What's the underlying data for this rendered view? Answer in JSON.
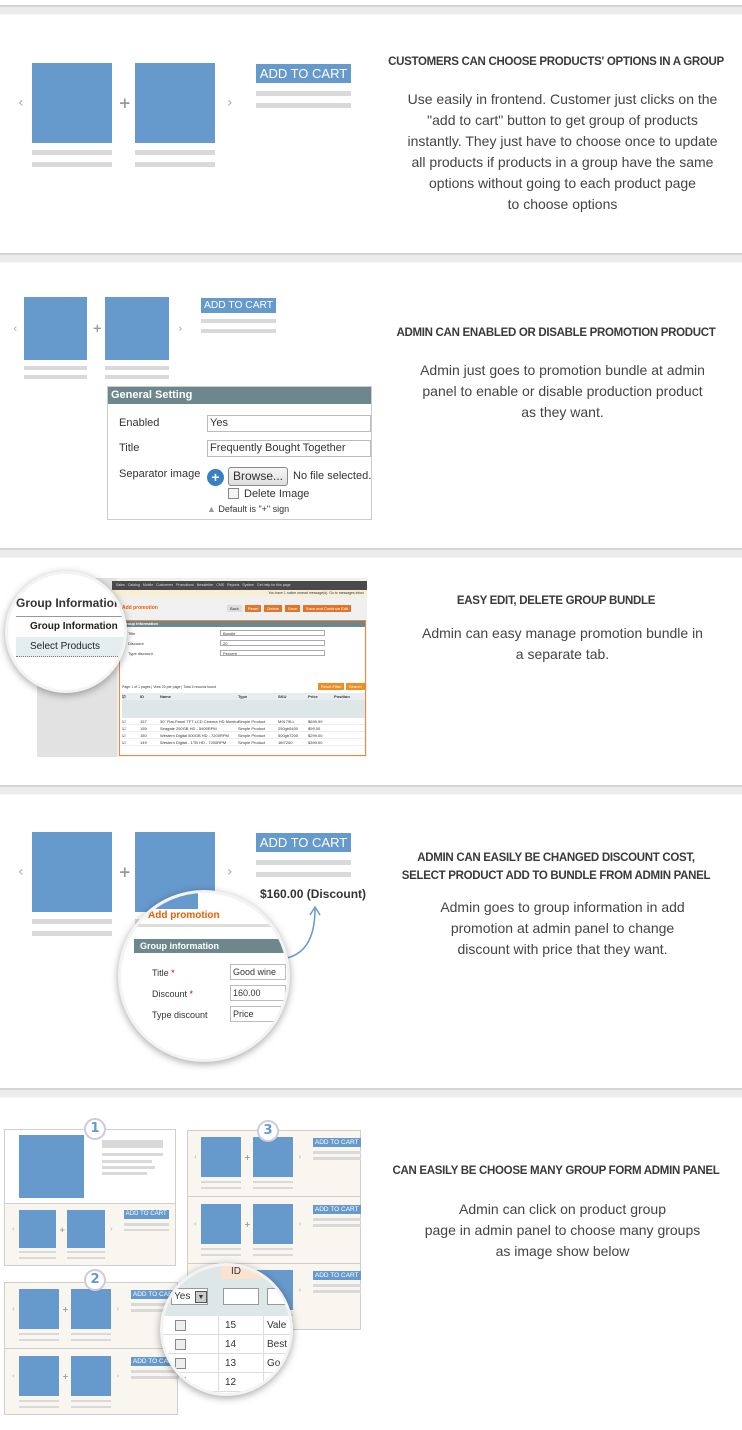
{
  "add_to_cart": "ADD TO CART",
  "colors": {
    "product_image": "#6699cc",
    "admin_bar": "#6e878d",
    "accent_orange": "#eb5e00"
  },
  "sections": [
    {
      "heading": [
        "CUSTOMERS CAN CHOOSE PRODUCTS' OPTIONS IN A GROUP"
      ],
      "text": [
        "Use easily in frontend. Customer just clicks on the",
        "\"add to cart\" button to get group of products",
        "instantly. They just have to choose once to update",
        "all products if products in a group have the same",
        "options without going to each product page",
        "to choose options"
      ]
    },
    {
      "heading": [
        "ADMIN CAN ENABLED OR DISABLE PROMOTION PRODUCT"
      ],
      "text": [
        "Admin just goes to promotion bundle at admin",
        "panel to enable or disable production product",
        "as they want."
      ]
    },
    {
      "heading": [
        "EASY EDIT, DELETE GROUP BUNDLE"
      ],
      "text": [
        "Admin can easy manage promotion bundle in",
        "a separate tab."
      ]
    },
    {
      "heading": [
        "ADMIN CAN EASILY BE CHANGED DISCOUNT COST,",
        "SELECT PRODUCT ADD TO BUNDLE FROM ADMIN PANEL"
      ],
      "text": [
        "Admin goes to group information in add",
        "promotion at admin panel to change",
        "discount with price that they want."
      ]
    },
    {
      "heading": [
        "CAN EASILY BE CHOOSE MANY GROUP FORM ADMIN PANEL"
      ],
      "text": [
        "Admin can click on product group",
        "page in admin panel to choose many groups",
        "as image show below"
      ]
    }
  ],
  "general_setting": {
    "title": "General Setting",
    "enabled_label": "Enabled",
    "enabled_value": "Yes",
    "title_label": "Title",
    "title_value": "Frequently Bought Together",
    "separator_label": "Separator image",
    "browse": "Browse...",
    "no_file": "No file selected.",
    "delete_image": "Delete Image",
    "default_note": "Default is \"+\" sign"
  },
  "group_tabs": {
    "heading": "Group Information",
    "items": [
      "Group Information",
      "Select Products"
    ]
  },
  "admin": {
    "nav": [
      "Sales",
      "Catalog",
      "Mobile",
      "Customers",
      "Promotions",
      "Newsletter",
      "CMS",
      "Reports",
      "System",
      "Get help for this page"
    ],
    "notice": "You have 1 notice unread message(s). Go to messages inbox",
    "page_title": "Add promotion",
    "buttons": [
      "Back",
      "Reset",
      "Delete",
      "Save",
      "Save and Continue Edit"
    ],
    "section": "Group information",
    "fields": [
      {
        "label": "Title",
        "value": "Bundle"
      },
      {
        "label": "Discount",
        "value": "20"
      },
      {
        "label": "Type discount",
        "value": "Percent"
      }
    ],
    "pager": "Page 1 of 1 pages | View 20 per page | Total 4 records found",
    "reset_filter": "Reset Filter",
    "search": "Search",
    "columns": [
      "ID",
      "Name",
      "Type",
      "SKU",
      "Price",
      "Position"
    ],
    "rows": [
      [
        "157",
        "30\" Flat-Panel TFT-LCD Cinema HD Monitor",
        "Simple Product",
        "M9179LL",
        "$699.99"
      ],
      [
        "155",
        "Seagate 250GB HD - 5400RPM",
        "Simple Product",
        "250gb5400",
        "$99.00"
      ],
      [
        "150",
        "Western Digital 500GB HD - 7200RPM",
        "Simple Product",
        "500gb7200",
        "$299.00"
      ],
      [
        "149",
        "Western Digital - 1TB HD - 7200RPM",
        "Simple Product",
        "1tb7200",
        "$399.00"
      ]
    ]
  },
  "discount_demo": {
    "price": "$160.00 (Discount)",
    "page_title": "Add promotion",
    "section": "Group information",
    "fields": [
      {
        "label": "Title",
        "value": "Good wine",
        "required": true
      },
      {
        "label": "Discount",
        "value": "160.00",
        "required": true
      },
      {
        "label": "Type discount",
        "value": "Price",
        "required": false
      }
    ]
  },
  "groups_demo": {
    "steps": [
      "1",
      "2",
      "3"
    ],
    "filter": "Yes",
    "id_header": "ID",
    "rows": [
      {
        "id": "15",
        "name": "Vale",
        "checked": false
      },
      {
        "id": "14",
        "name": "Best",
        "checked": false
      },
      {
        "id": "13",
        "name": "Go",
        "checked": false
      },
      {
        "id": "12",
        "name": "",
        "checked": true
      }
    ]
  }
}
